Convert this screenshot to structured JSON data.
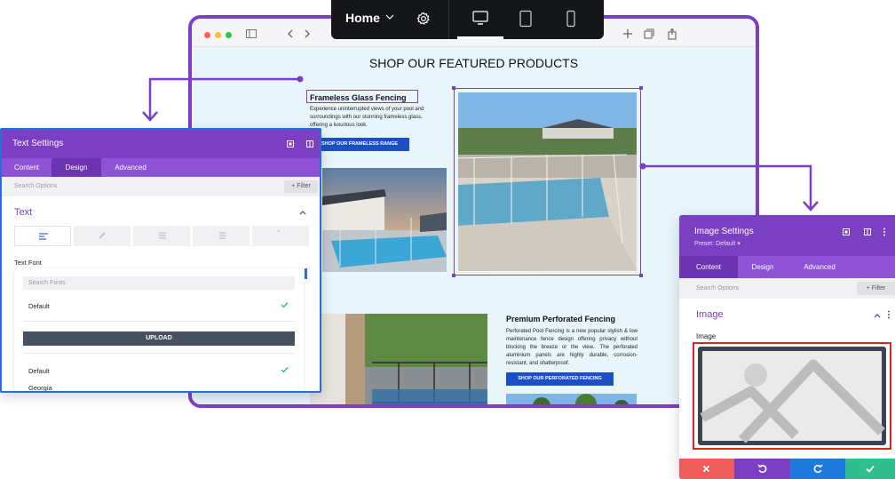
{
  "toolbar": {
    "page_label": "Home",
    "icons": [
      "chevron-down-icon",
      "gear-icon",
      "desktop-icon",
      "tablet-icon",
      "phone-icon"
    ],
    "active_device": "desktop"
  },
  "browser": {
    "traffic_lights": [
      "#fd5f57",
      "#febb2e",
      "#28c840"
    ]
  },
  "page": {
    "heading": "SHOP OUR FEATURED PRODUCTS",
    "products": [
      {
        "title": "Frameless Glass Fencing",
        "description": "Experience uninterrupted views of your pool and surroundings with our stunning frameless glass, offering a luxurious look.",
        "button": "SHOP OUR FRAMELESS RANGE"
      },
      {
        "title": "Premium Perforated Fencing",
        "description": "Perforated Pool Fencing is a new popular stylish & low maintenance fence design offering privacy without blocking the breeze or the view.. The perforated aluminium panels are highly durable, corrosion-resistant, and shatterproof.",
        "button": "SHOP OUR PERFORATED FENCING"
      }
    ]
  },
  "text_settings": {
    "title": "Text Settings",
    "tabs": [
      "Content",
      "Design",
      "Advanced"
    ],
    "active_tab": "Design",
    "search_placeholder": "Search Options",
    "filter_label": "+ Filter",
    "section": "Text",
    "field_label": "Text Font",
    "font_search_placeholder": "Search Fonts",
    "upload_label": "UPLOAD",
    "font_options": [
      "Default",
      "Default",
      "Georgia"
    ]
  },
  "image_settings": {
    "title": "Image Settings",
    "preset": "Preset: Default ▾",
    "tabs": [
      "Content",
      "Design",
      "Advanced"
    ],
    "active_tab": "Content",
    "search_placeholder": "Search Options",
    "filter_label": "+ Filter",
    "section": "Image",
    "field_label": "Image",
    "footer_buttons": [
      "discard",
      "undo",
      "redo",
      "save"
    ]
  },
  "colors": {
    "accent": "#7b3fc4",
    "tab_bar": "#8e52d6",
    "button_blue": "#1d4fc4",
    "discard": "#ef5b5b",
    "undo": "#7b3fc4",
    "redo": "#1f7ae0",
    "save": "#2fbf8f",
    "check": "#2fbf8f"
  }
}
